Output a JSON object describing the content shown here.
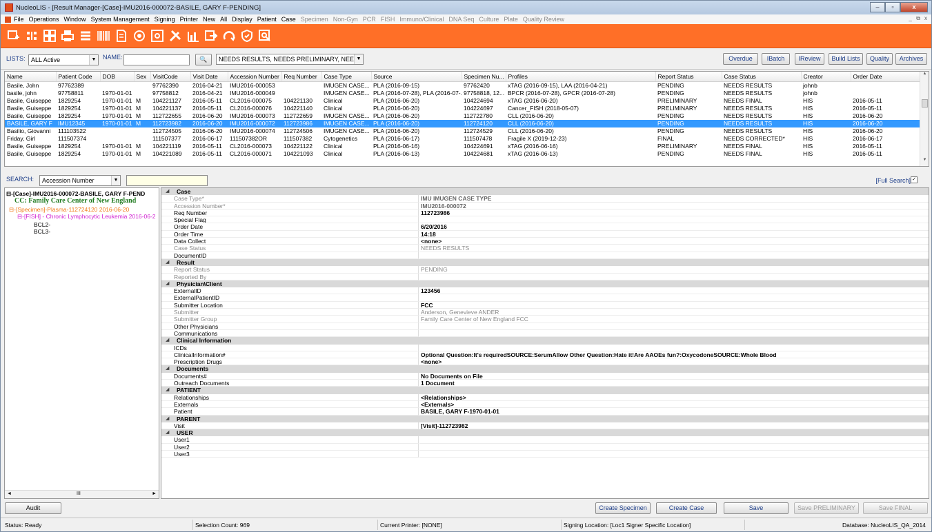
{
  "window": {
    "title": "NucleoLIS - [Result Manager-[Case]-IMU2016-000072-BASILE, GARY F-PENDING]",
    "min": "–",
    "max": "▫",
    "close": "x"
  },
  "menu": {
    "items": [
      "File",
      "Operations",
      "Window",
      "System Management",
      "Signing",
      "Printer",
      "New",
      "All",
      "Display",
      "Patient",
      "Case"
    ],
    "dim_items": [
      "Specimen",
      "Non-Gyn",
      "PCR",
      "FISH",
      "Immuno/Clinical",
      "DNA Seq",
      "Culture",
      "Plate",
      "Quality Review"
    ],
    "mdi": "_ ⧉ x"
  },
  "toolbar": {
    "icons": [
      "add-case-icon",
      "barcode-scan-icon",
      "grid-icon",
      "printer-icon",
      "list-icon",
      "barcode-icon",
      "document-icon",
      "search-record-icon",
      "report-icon",
      "tools-icon",
      "chart-icon",
      "export-icon",
      "refresh-icon",
      "shield-icon",
      "search-icon"
    ]
  },
  "lists": {
    "label": "LISTS:",
    "value": "ALL Active",
    "name_label": "NAME:",
    "name_value": "",
    "binoculars": "🔍",
    "filter": "NEEDS RESULTS, NEEDS PRELIMINARY, NEEDS ...",
    "buttons": [
      "Overdue",
      "IBatch",
      "IReview",
      "Build Lists",
      "Quality",
      "Archives"
    ]
  },
  "grid": {
    "columns": [
      "Name",
      "Patient Code",
      "DOB",
      "Sex",
      "VisitCode",
      "Visit Date",
      "Accession Number",
      "Req Number",
      "Case Type",
      "Source",
      "Specimen Nu...",
      "Profiles",
      "Report Status",
      "Case Status",
      "Creator",
      "Order Date"
    ],
    "rows": [
      [
        "Basile, John",
        "97762389",
        "",
        "",
        "97762390",
        "2016-04-21",
        "IMU2016-000053",
        "",
        "IMUGEN CASE...",
        "PLA (2016-09-15)",
        "97762420",
        "xTAG (2016-09-15), LAA (2016-04-21)",
        "PENDING",
        "NEEDS RESULTS",
        "johnb",
        ""
      ],
      [
        "basile, john",
        "97758811",
        "1970-01-01",
        "",
        "97758812",
        "2016-04-21",
        "IMU2016-000049",
        "",
        "IMUGEN CASE...",
        "PLA (2016-07-28), PLA (2016-07-...",
        "97758818, 12...",
        "BPCR (2016-07-28), GPCR (2016-07-28)",
        "PENDING",
        "NEEDS RESULTS",
        "johnb",
        ""
      ],
      [
        "Basile, Guiseppe",
        "1829254",
        "1970-01-01",
        "M",
        "104221127",
        "2016-05-11",
        "CL2016-000075",
        "104221130",
        "Clinical",
        "PLA (2016-06-20)",
        "104224694",
        "xTAG (2016-06-20)",
        "PRELIMINARY",
        "NEEDS FINAL",
        "HIS",
        "2016-05-11"
      ],
      [
        "Basile, Guiseppe",
        "1829254",
        "1970-01-01",
        "M",
        "104221137",
        "2016-05-11",
        "CL2016-000076",
        "104221140",
        "Clinical",
        "PLA (2016-06-20)",
        "104224697",
        "Cancer_FISH (2018-05-07)",
        "PRELIMINARY",
        "NEEDS RESULTS",
        "HIS",
        "2016-05-11"
      ],
      [
        "Basile, Guiseppe",
        "1829254",
        "1970-01-01",
        "M",
        "112722655",
        "2016-06-20",
        "IMU2016-000073",
        "112722659",
        "IMUGEN CASE...",
        "PLA (2016-06-20)",
        "112722780",
        "CLL (2016-06-20)",
        "PENDING",
        "NEEDS RESULTS",
        "HIS",
        "2016-06-20"
      ],
      [
        "BASILE, GARY F",
        "IMU12345",
        "1970-01-01",
        "M",
        "112723982",
        "2016-06-20",
        "IMU2016-000072",
        "112723986",
        "IMUGEN CASE...",
        "PLA (2016-06-20)",
        "112724120",
        "CLL (2016-06-20)",
        "PENDING",
        "NEEDS RESULTS",
        "HIS",
        "2016-06-20"
      ],
      [
        "Basilio, Giovanni",
        "111103522",
        "",
        "",
        "112724505",
        "2016-06-20",
        "IMU2016-000074",
        "112724506",
        "IMUGEN CASE...",
        "PLA (2016-06-20)",
        "112724529",
        "CLL (2016-06-20)",
        "PENDING",
        "NEEDS RESULTS",
        "HIS",
        "2016-06-20"
      ],
      [
        "Friday, Girl",
        "111507374",
        "",
        "",
        "111507377",
        "2016-06-17",
        "111507382OR",
        "111507382",
        "Cytogenetics",
        "PLA (2016-06-17)",
        "111507478",
        "Fragile X (2019-12-23)",
        "FINAL",
        "NEEDS CORRECTED*",
        "HIS",
        "2016-06-17"
      ],
      [
        "Basile, Guiseppe",
        "1829254",
        "1970-01-01",
        "M",
        "104221119",
        "2016-05-11",
        "CL2016-000073",
        "104221122",
        "Clinical",
        "PLA (2016-06-16)",
        "104224691",
        "xTAG (2016-06-16)",
        "PRELIMINARY",
        "NEEDS FINAL",
        "HIS",
        "2016-05-11"
      ],
      [
        "Basile, Guiseppe",
        "1829254",
        "1970-01-01",
        "M",
        "104221089",
        "2016-05-11",
        "CL2016-000071",
        "104221093",
        "Clinical",
        "PLA (2016-06-13)",
        "104224681",
        "xTAG (2016-06-13)",
        "PENDING",
        "NEEDS FINAL",
        "HIS",
        "2016-05-11"
      ]
    ],
    "selected_row": 5
  },
  "search": {
    "label": "SEARCH:",
    "field": "Accession Number",
    "value": "",
    "full_search": "[Full Search]",
    "full_search_checked": "✓"
  },
  "tree": {
    "case": "[Case]-IMU2016-000072-BASILE, GARY F-PEND",
    "cc": "CC: Family Care Center of New England",
    "specimen": "[Specimen]-Plasma-112724120 2016-06-20",
    "fish": "[FISH] - Chronic Lymphocytic Leukemia 2016-06-2",
    "bcl2": "BCL2-",
    "bcl3": "BCL3-",
    "hscroll_mark": "III"
  },
  "props": [
    {
      "cat": "Case"
    },
    {
      "k": "Case Type*",
      "v": "IMU IMUGEN CASE TYPE",
      "ro": true,
      "vb": true
    },
    {
      "k": "Accession Number*",
      "v": "IMU2016-000072",
      "ro": true,
      "vb": true
    },
    {
      "k": "Req Number",
      "v": "112723986"
    },
    {
      "k": "Special Flag",
      "v": ""
    },
    {
      "k": "Order Date",
      "v": "6/20/2016"
    },
    {
      "k": "Order Time",
      "v": "14:18"
    },
    {
      "k": "Data Collect",
      "v": "<none>"
    },
    {
      "k": "Case Status",
      "v": "NEEDS RESULTS",
      "ro": true
    },
    {
      "k": "DocumentID",
      "v": ""
    },
    {
      "cat": "Result"
    },
    {
      "k": "Report Status",
      "v": "PENDING",
      "ro": true
    },
    {
      "k": "Reported By",
      "v": "",
      "ro": true
    },
    {
      "cat": "Physician\\Client"
    },
    {
      "k": "ExternalID",
      "v": "123456"
    },
    {
      "k": "ExternalPatientID",
      "v": ""
    },
    {
      "k": "Submitter Location",
      "v": "FCC"
    },
    {
      "k": "Submitter",
      "v": "Anderson, Genevieve ANDER",
      "ro": true
    },
    {
      "k": "Submitter Group",
      "v": "Family Care Center of New England FCC",
      "ro": true
    },
    {
      "k": "Other Physicians",
      "v": ""
    },
    {
      "k": "Communications",
      "v": ""
    },
    {
      "cat": "Clinical Information"
    },
    {
      "k": "ICDs",
      "v": ""
    },
    {
      "k": "ClinicalInformation#",
      "v": "Optional Question:It's requiredSOURCE:SerumAllow Other Question:Hate it!Are AAOEs fun?:OxycodoneSOURCE:Whole Blood"
    },
    {
      "k": "Prescription Drugs",
      "v": "<none>"
    },
    {
      "cat": "Documents"
    },
    {
      "k": "Documents#",
      "v": "No Documents on File"
    },
    {
      "k": "Outreach Documents",
      "v": "1 Document"
    },
    {
      "cat": "PATIENT"
    },
    {
      "k": "Relationships",
      "v": "<Relationships>"
    },
    {
      "k": "Externals",
      "v": "<Externals>"
    },
    {
      "k": "Patient",
      "v": "BASILE, GARY F-1970-01-01"
    },
    {
      "cat": "PARENT"
    },
    {
      "k": "Visit",
      "v": "[Visit]-112723982"
    },
    {
      "cat": "USER"
    },
    {
      "k": "User1",
      "v": ""
    },
    {
      "k": "User2",
      "v": ""
    },
    {
      "k": "User3",
      "v": ""
    }
  ],
  "bottom": {
    "audit": "Audit",
    "create_specimen": "Create Specimen",
    "create_case": "Create Case",
    "save": "Save",
    "save_prelim": "Save PRELIMINARY",
    "save_final": "Save FINAL"
  },
  "status": {
    "ready": "Status: Ready",
    "selection": "Selection Count: 969",
    "printer": "Current Printer: [NONE]",
    "signing": "Signing Location: [Loc1 Signer Specific Location]",
    "database": "Database: NucleoLIS_QA_2014"
  },
  "colors": {
    "accent": "#ff6f27",
    "selected": "#3399ff",
    "link": "#1b3c88"
  }
}
